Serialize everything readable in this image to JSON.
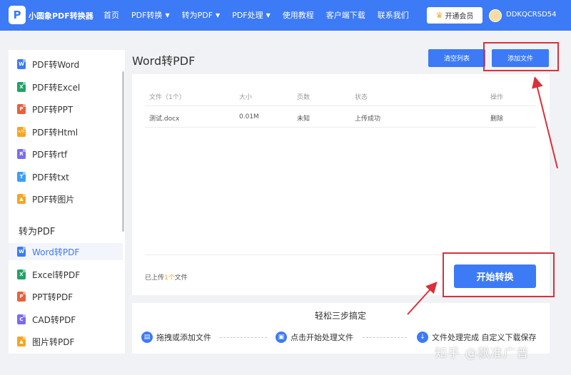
{
  "header": {
    "logo_glyph": "P",
    "brand": "小圆象PDF转换器",
    "nav": [
      {
        "label": "首页",
        "has_dropdown": false
      },
      {
        "label": "PDF转换",
        "has_dropdown": true
      },
      {
        "label": "转为PDF",
        "has_dropdown": true
      },
      {
        "label": "PDF处理",
        "has_dropdown": true
      },
      {
        "label": "使用教程",
        "has_dropdown": false
      },
      {
        "label": "客户端下载",
        "has_dropdown": false
      },
      {
        "label": "联系我们",
        "has_dropdown": false
      }
    ],
    "vip_label": "开通会员",
    "username": "DDKQCRSD54"
  },
  "sidebar": {
    "items": [
      {
        "label": "PDF转Word",
        "icon": "word-icon",
        "color": "#3d7af5",
        "glyph": "W"
      },
      {
        "label": "PDF转Excel",
        "icon": "excel-icon",
        "color": "#21a366",
        "glyph": "X"
      },
      {
        "label": "PDF转PPT",
        "icon": "ppt-icon",
        "color": "#e8613c",
        "glyph": "P"
      },
      {
        "label": "PDF转Html",
        "icon": "html-icon",
        "color": "#f5a623",
        "glyph": "</>"
      },
      {
        "label": "PDF转rtf",
        "icon": "rtf-icon",
        "color": "#7a6cf0",
        "glyph": "R"
      },
      {
        "label": "PDF转txt",
        "icon": "txt-icon",
        "color": "#3d9ef5",
        "glyph": "T"
      },
      {
        "label": "PDF转图片",
        "icon": "image-icon",
        "color": "#f5a623",
        "glyph": "▲"
      }
    ],
    "section_title": "转为PDF",
    "section_items": [
      {
        "label": "Word转PDF",
        "icon": "word-icon",
        "color": "#3d7af5",
        "glyph": "W",
        "active": true
      },
      {
        "label": "Excel转PDF",
        "icon": "excel-icon",
        "color": "#21a366",
        "glyph": "X",
        "active": false
      },
      {
        "label": "PPT转PDF",
        "icon": "ppt-icon",
        "color": "#e8613c",
        "glyph": "P",
        "active": false
      },
      {
        "label": "CAD转PDF",
        "icon": "cad-icon",
        "color": "#7a6cf0",
        "glyph": "C",
        "active": false
      },
      {
        "label": "图片转PDF",
        "icon": "image-icon",
        "color": "#f5a623",
        "glyph": "▲",
        "active": false
      }
    ]
  },
  "main": {
    "title": "Word转PDF",
    "clear_label": "清空列表",
    "add_label": "添加文件",
    "table": {
      "headers": [
        "文件（1个）",
        "大小",
        "页数",
        "状态",
        "操作"
      ],
      "rows": [
        [
          "测试.docx",
          "0.01M",
          "未知",
          "上传成功",
          "删除"
        ]
      ]
    },
    "uploaded_prefix": "已上传",
    "uploaded_count": "1个",
    "uploaded_suffix": "文件",
    "start_label": "开始转换"
  },
  "steps": {
    "title": "轻松三步搞定",
    "items": [
      {
        "label": "拖拽或添加文件",
        "icon": "file-icon"
      },
      {
        "label": "点击开始处理文件",
        "icon": "process-icon"
      },
      {
        "label": "文件处理完成 自定义下载保存",
        "icon": "download-icon"
      }
    ]
  },
  "watermark": "知乎 @飘准广普",
  "colors": {
    "accent": "#3d7af5",
    "annotation_red": "#d9313a",
    "highlight": "#f5a623"
  }
}
